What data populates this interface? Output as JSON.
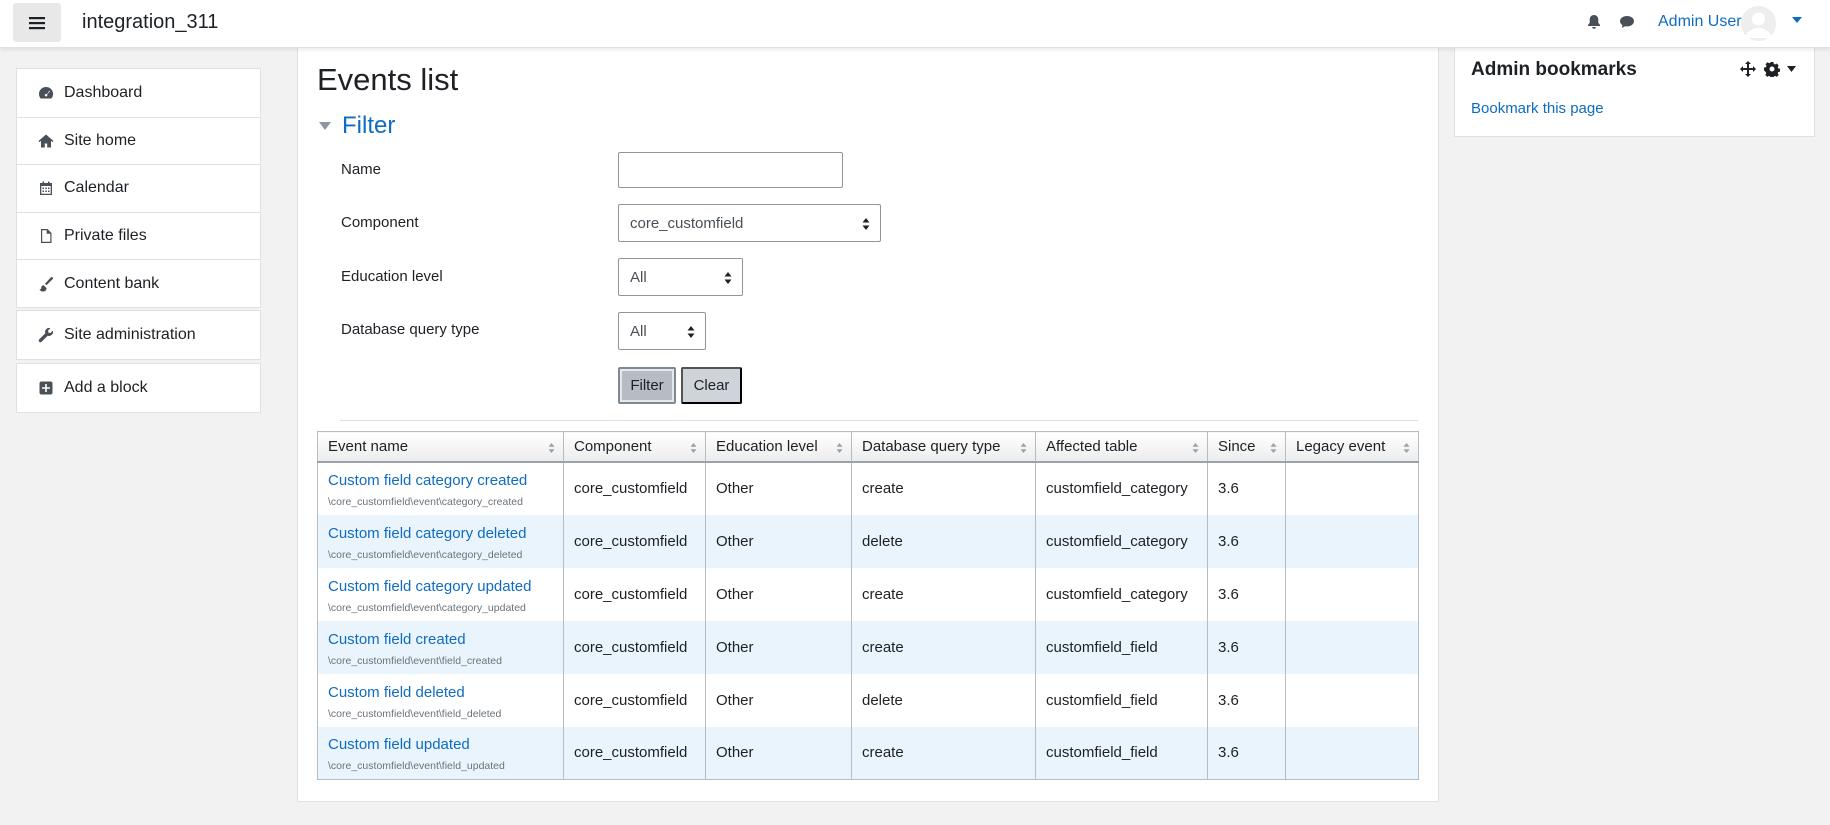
{
  "header": {
    "site_name": "integration_311",
    "user_name": "Admin User"
  },
  "nav": {
    "group1": [
      {
        "label": "Dashboard",
        "icon": "dashboard-icon"
      },
      {
        "label": "Site home",
        "icon": "home-icon"
      },
      {
        "label": "Calendar",
        "icon": "calendar-icon"
      },
      {
        "label": "Private files",
        "icon": "file-icon"
      },
      {
        "label": "Content bank",
        "icon": "paintbrush-icon"
      }
    ],
    "group2": [
      {
        "label": "Site administration",
        "icon": "wrench-icon"
      }
    ],
    "group3": [
      {
        "label": "Add a block",
        "icon": "plus-square-icon"
      }
    ]
  },
  "page": {
    "title": "Events list",
    "filter_heading": "Filter"
  },
  "filter": {
    "name_label": "Name",
    "name_value": "",
    "component_label": "Component",
    "component_value": "core_customfield",
    "edulevel_label": "Education level",
    "edulevel_value": "All",
    "crud_label": "Database query type",
    "crud_value": "All",
    "filter_button": "Filter",
    "clear_button": "Clear"
  },
  "table": {
    "headers": [
      "Event name",
      "Component",
      "Education level",
      "Database query type",
      "Affected table",
      "Since",
      "Legacy event"
    ],
    "rows": [
      {
        "name": "Custom field category created",
        "path": "\\core_customfield\\event\\category_created",
        "component": "core_customfield",
        "edulevel": "Other",
        "crud": "create",
        "table": "customfield_category",
        "since": "3.6",
        "legacy": ""
      },
      {
        "name": "Custom field category deleted",
        "path": "\\core_customfield\\event\\category_deleted",
        "component": "core_customfield",
        "edulevel": "Other",
        "crud": "delete",
        "table": "customfield_category",
        "since": "3.6",
        "legacy": ""
      },
      {
        "name": "Custom field category updated",
        "path": "\\core_customfield\\event\\category_updated",
        "component": "core_customfield",
        "edulevel": "Other",
        "crud": "create",
        "table": "customfield_category",
        "since": "3.6",
        "legacy": ""
      },
      {
        "name": "Custom field created",
        "path": "\\core_customfield\\event\\field_created",
        "component": "core_customfield",
        "edulevel": "Other",
        "crud": "create",
        "table": "customfield_field",
        "since": "3.6",
        "legacy": ""
      },
      {
        "name": "Custom field deleted",
        "path": "\\core_customfield\\event\\field_deleted",
        "component": "core_customfield",
        "edulevel": "Other",
        "crud": "delete",
        "table": "customfield_field",
        "since": "3.6",
        "legacy": ""
      },
      {
        "name": "Custom field updated",
        "path": "\\core_customfield\\event\\field_updated",
        "component": "core_customfield",
        "edulevel": "Other",
        "crud": "create",
        "table": "customfield_field",
        "since": "3.6",
        "legacy": ""
      }
    ]
  },
  "block": {
    "title": "Admin bookmarks",
    "link": "Bookmark this page"
  },
  "colors": {
    "link": "#0f6cbf",
    "row_alt": "#eaf4fc",
    "button": "#ced4da"
  }
}
